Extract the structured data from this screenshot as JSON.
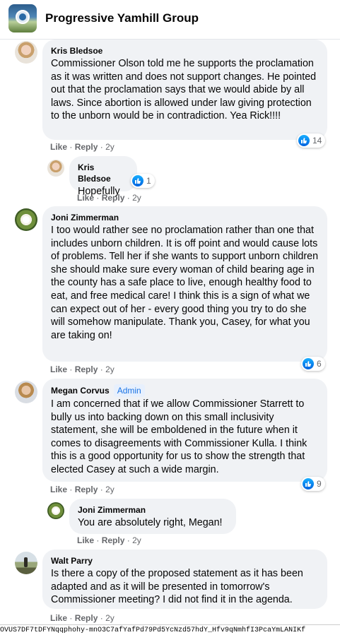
{
  "group": {
    "title": "Progressive Yamhill Group"
  },
  "comments": [
    {
      "author": "Kris Bledsoe",
      "text": "Commissioner Olson told me he supports the proclamation as it was written and does not support changes. He pointed out that the proclamation says that we would abide by all laws. Since abortion is allowed under law giving protection to the unborn would be in contradiction. Yea Rick!!!!",
      "reactions": "14",
      "like": "Like",
      "reply": "Reply",
      "time": "2y"
    },
    {
      "author": "Kris Bledsoe",
      "text": "Hopefully",
      "reactions": "1",
      "like": "Like",
      "reply": "Reply",
      "time": "2y"
    },
    {
      "author": "Joni Zimmerman",
      "text": "I too would rather see no proclamation rather than one that includes unborn children. It is off point and would cause lots of problems. Tell her if she wants to support unborn children she should make sure every woman of child bearing age in the county has a safe place to live, enough healthy food to eat, and free medical care! I think this is a sign of what we can expect out of her - every good thing you try to do she will somehow manipulate. Thank you, Casey, for what you are taking on!",
      "reactions": "6",
      "like": "Like",
      "reply": "Reply",
      "time": "2y"
    },
    {
      "author": "Megan Corvus",
      "badge": "Admin",
      "text": "I am concerned that if we allow Commissioner Starrett to bully us into backing down on this small inclusivity statement, she will be emboldened in the future when it comes to disagreements with Commissioner Kulla. I think this is a good opportunity for us to show the strength that elected Casey at such a wide margin.",
      "reactions": "9",
      "like": "Like",
      "reply": "Reply",
      "time": "2y"
    },
    {
      "author": "Joni Zimmerman",
      "text": "You are absolutely right, Megan!",
      "like": "Like",
      "reply": "Reply",
      "time": "2y"
    },
    {
      "author": "Walt Parry",
      "text": "Is there a copy of the proposed statement as it has been adapted and as it will be presented in tomorrow's Commissioner meeting? I did not find it in the agenda.",
      "like": "Like",
      "reply": "Reply",
      "time": "2y"
    }
  ],
  "separator": "·",
  "url_fragment": "OVUS7DF7tDFYNqqphohy-mnO3C7afYafPd79Pd5YcNzd57hdY_Hfv9qNmhfI3PcaYmLANIKf",
  "colors": {
    "like_blue": "#1877f2",
    "bubble_bg": "#f0f2f5",
    "admin_badge": "#1b74e4"
  }
}
